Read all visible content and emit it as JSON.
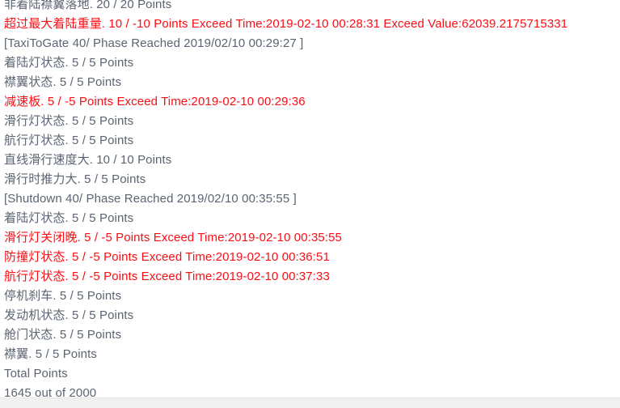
{
  "panel": {
    "name": "flight-score-report",
    "background_color": "#ffffff",
    "normal_text_color": "#5b6472",
    "penalty_text_color": "#fb0d14",
    "footer_band_color": "#f1f1f1"
  },
  "lines": [
    {
      "kind": "normal",
      "text": "非着陆襟翼落地. 20 / 20 Points"
    },
    {
      "kind": "penalty",
      "text": "超过最大着陆重量. 10 / -10 Points Exceed Time:2019-02-10 00:28:31 Exceed Value:62039.2175715331"
    },
    {
      "kind": "phase",
      "text": "[TaxiToGate 40/ Phase Reached 2019/02/10 00:29:27 ]"
    },
    {
      "kind": "normal",
      "text": "着陆灯状态. 5 / 5 Points"
    },
    {
      "kind": "normal",
      "text": "襟翼状态. 5 / 5 Points"
    },
    {
      "kind": "penalty",
      "text": "减速板. 5 / -5 Points Exceed Time:2019-02-10 00:29:36"
    },
    {
      "kind": "normal",
      "text": "滑行灯状态. 5 / 5 Points"
    },
    {
      "kind": "normal",
      "text": "航行灯状态. 5 / 5 Points"
    },
    {
      "kind": "normal",
      "text": "直线滑行速度大. 10 / 10 Points"
    },
    {
      "kind": "normal",
      "text": "滑行时推力大. 5 / 5 Points"
    },
    {
      "kind": "phase",
      "text": "[Shutdown 40/ Phase Reached 2019/02/10 00:35:55 ]"
    },
    {
      "kind": "normal",
      "text": "着陆灯状态. 5 / 5 Points"
    },
    {
      "kind": "penalty",
      "text": "滑行灯关闭晚. 5 / -5 Points Exceed Time:2019-02-10 00:35:55"
    },
    {
      "kind": "penalty",
      "text": "防撞灯状态. 5 / -5 Points Exceed Time:2019-02-10 00:36:51"
    },
    {
      "kind": "penalty",
      "text": "航行灯状态. 5 / -5 Points Exceed Time:2019-02-10 00:37:33"
    },
    {
      "kind": "normal",
      "text": "停机刹车. 5 / 5 Points"
    },
    {
      "kind": "normal",
      "text": "发动机状态. 5 / 5 Points"
    },
    {
      "kind": "normal",
      "text": "舱门状态. 5 / 5 Points"
    },
    {
      "kind": "normal",
      "text": "襟翼. 5 / 5 Points"
    },
    {
      "kind": "total-label",
      "text": "Total Points"
    },
    {
      "kind": "total-value",
      "text": "1645 out of 2000"
    }
  ]
}
